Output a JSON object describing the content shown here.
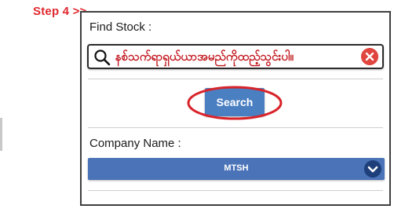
{
  "annotation": {
    "step_label": "Step 4 >>"
  },
  "form": {
    "find_stock_label": "Find Stock :",
    "search_field_value": "နစ်သက်ရာရှယ်ယာအမည်ကိုထည့်သွင်းပါ။",
    "search_button_label": "Search",
    "company_name_label": "Company Name :",
    "company_selected": "MTSH"
  },
  "icons": {
    "search": "magnifier-icon",
    "clear": "clear-x-icon",
    "dropdown": "chevron-down-icon"
  },
  "colors": {
    "annotation_red": "#e0282e",
    "button_blue": "#4a7fc2",
    "select_blue": "#4a73b8",
    "clear_red": "#e0463f"
  }
}
